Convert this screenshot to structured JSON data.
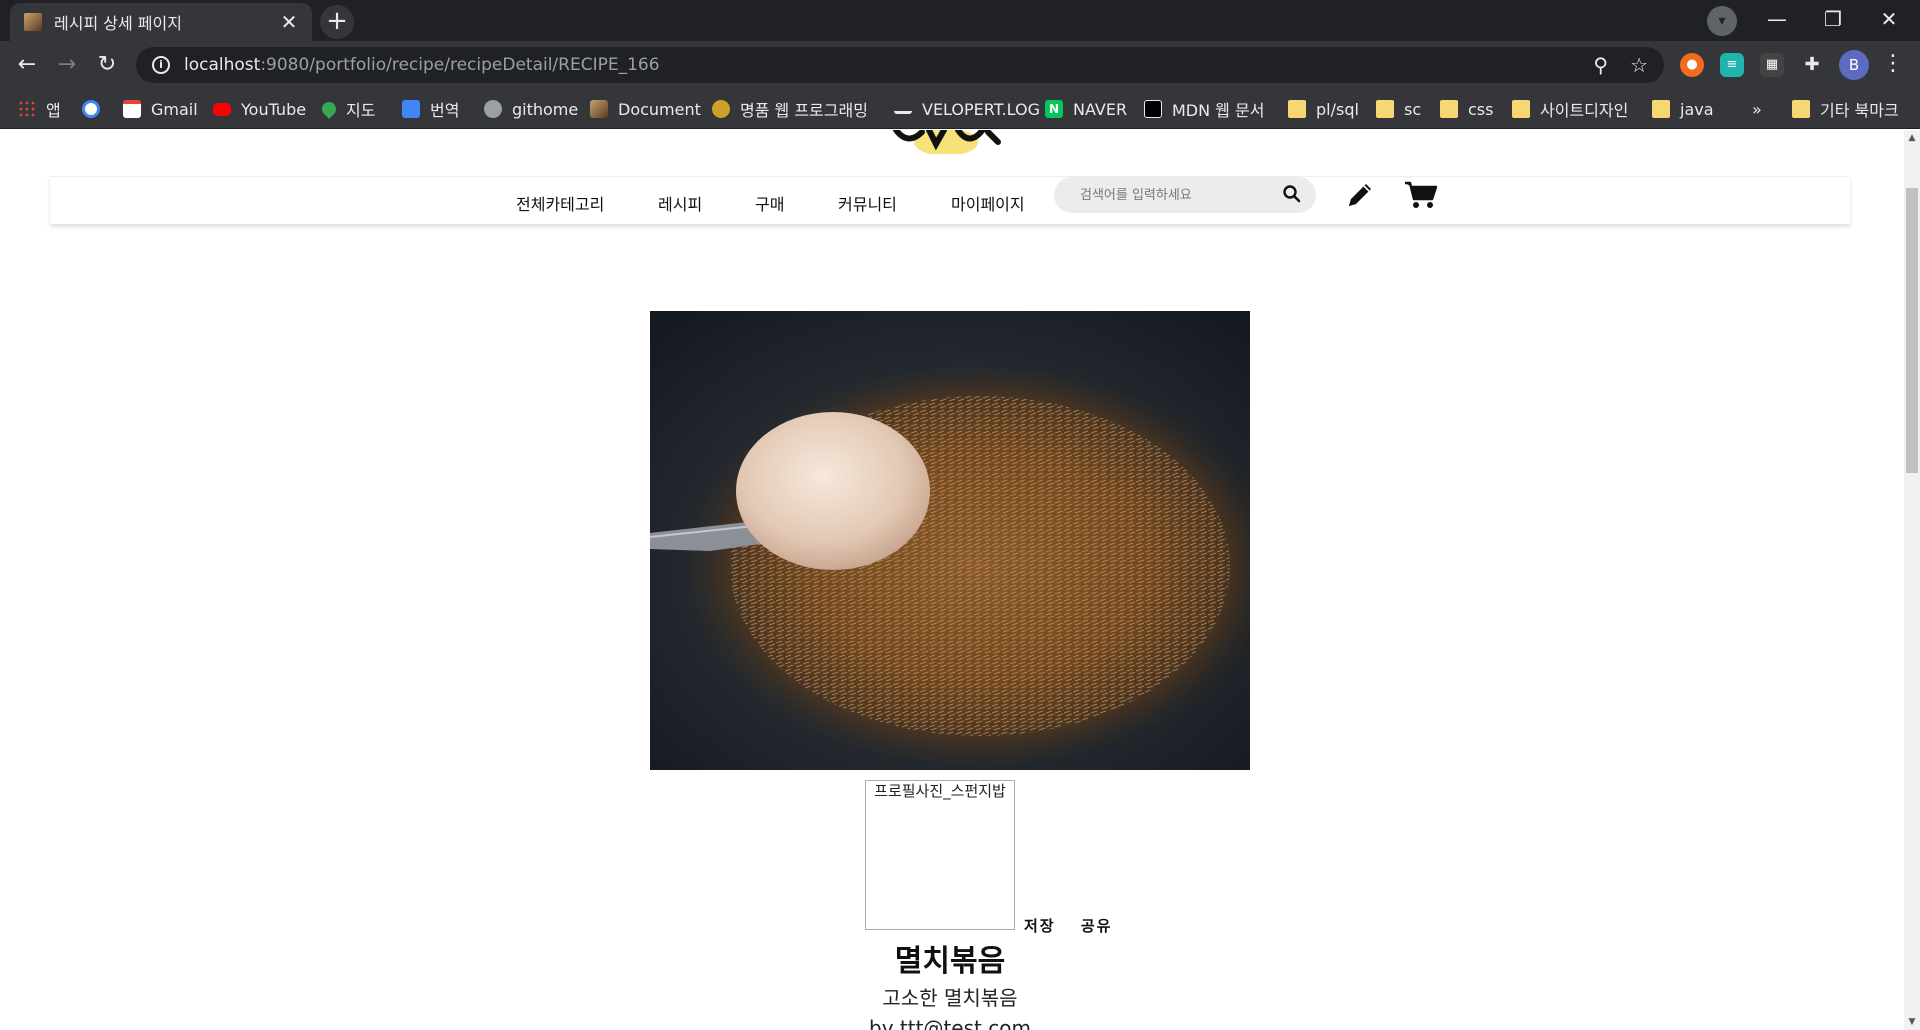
{
  "browser": {
    "tab_title": "레시피 상세 페이지",
    "url_host": "localhost",
    "url_path": ":9080/portfolio/recipe/recipeDetail/RECIPE_166",
    "avatar_letter": "B"
  },
  "bookmarks": {
    "items": [
      {
        "label": "앱",
        "icon": "apps-grid-icon"
      },
      {
        "label": "",
        "icon": "google-icon"
      },
      {
        "label": "Gmail",
        "icon": "gmail-icon"
      },
      {
        "label": "YouTube",
        "icon": "youtube-icon"
      },
      {
        "label": "지도",
        "icon": "maps-icon"
      },
      {
        "label": "번역",
        "icon": "translate-icon"
      },
      {
        "label": "githome",
        "icon": "globe-icon"
      },
      {
        "label": "Document",
        "icon": "document-icon"
      },
      {
        "label": "명품 웹 프로그래밍",
        "icon": "site-icon"
      },
      {
        "label": "VELOPERT.LOG",
        "icon": "velopert-icon"
      },
      {
        "label": "NAVER",
        "icon": "naver-icon"
      },
      {
        "label": "MDN 웹 문서",
        "icon": "mdn-icon"
      },
      {
        "label": "pl/sql",
        "icon": "folder-icon"
      },
      {
        "label": "sc",
        "icon": "folder-icon"
      },
      {
        "label": "css",
        "icon": "folder-icon"
      },
      {
        "label": "사이트디자인",
        "icon": "folder-icon"
      },
      {
        "label": "java",
        "icon": "folder-icon"
      }
    ],
    "overflow": "»",
    "other": "기타 북마크"
  },
  "site": {
    "nav": [
      "전체카테고리",
      "레시피",
      "구매",
      "커뮤니티",
      "마이페이지"
    ],
    "search_placeholder": "검색어를 입력하세요"
  },
  "recipe": {
    "profile_alt": "프로필사진_스펀지밥",
    "save": "저장",
    "share": "공유",
    "title": "멸치볶음",
    "subtitle": "고소한 멸치볶음",
    "author": "by ttt@test.com"
  },
  "colors": {
    "tab_bg": "#35363a",
    "chrome_dark": "#202124",
    "search_bg": "#ececec"
  }
}
